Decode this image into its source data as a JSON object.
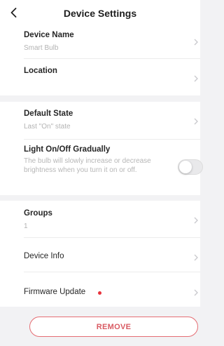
{
  "header": {
    "title": "Device Settings",
    "back_icon": "chevron-left-icon"
  },
  "settings": {
    "device_name": {
      "label": "Device Name",
      "value": "Smart Bulb"
    },
    "location": {
      "label": "Location"
    },
    "default_state": {
      "label": "Default State",
      "value": "Last \"On\" state"
    },
    "gradual": {
      "label": "Light On/Off Gradually",
      "description": "The bulb will slowly increase or decrease brightness when you turn it on or off.",
      "enabled": false
    },
    "groups": {
      "label": "Groups",
      "value": "1"
    },
    "device_info": {
      "label": "Device Info"
    },
    "firmware": {
      "label": "Firmware Update",
      "has_update": true
    }
  },
  "actions": {
    "remove_label": "REMOVE"
  },
  "colors": {
    "background": "#f2f2f4",
    "accent_red": "#e8333c",
    "remove_border": "#e56e74",
    "secondary_text": "#b3b3b3"
  }
}
